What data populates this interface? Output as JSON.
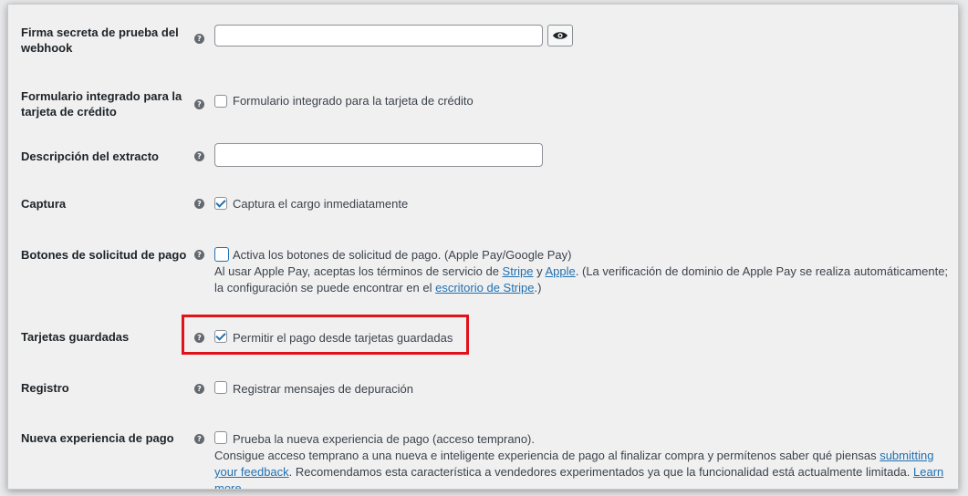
{
  "rows": {
    "webhook": {
      "label": "Firma secreta de prueba del webhook",
      "value": ""
    },
    "form": {
      "label": "Formulario integrado para la tarjeta de crédito",
      "checkbox": "Formulario integrado para la tarjeta de crédito",
      "checked": false
    },
    "statement": {
      "label": "Descripción del extracto",
      "value": ""
    },
    "capture": {
      "label": "Captura",
      "checkbox": "Captura el cargo inmediatamente",
      "checked": true
    },
    "payreq": {
      "label": "Botones de solicitud de pago",
      "checkbox": "Activa los botones de solicitud de pago. (Apple Pay/Google Pay)",
      "checked": false,
      "desc_a": "Al usar Apple Pay, aceptas los términos de servicio de ",
      "link_stripe": "Stripe",
      "desc_b": " y ",
      "link_apple": "Apple",
      "desc_c": ". (La verificación de dominio de Apple Pay se realiza automáticamente; la configuración se puede encontrar en el ",
      "link_dashboard": "escritorio de Stripe",
      "desc_d": ".)"
    },
    "saved": {
      "label": "Tarjetas guardadas",
      "checkbox": "Permitir el pago desde tarjetas guardadas",
      "checked": true
    },
    "log": {
      "label": "Registro",
      "checkbox": "Registrar mensajes de depuración",
      "checked": false
    },
    "newexp": {
      "label": "Nueva experiencia de pago",
      "checkbox": "Prueba la nueva experiencia de pago (acceso temprano).",
      "checked": false,
      "desc_a": "Consigue acceso temprano a una nueva e inteligente experiencia de pago al finalizar compra y permítenos saber qué piensas ",
      "link_feedback": "submitting your feedback",
      "desc_b": ". Recomendamos esta característica a vendedores experimentados ya que la funcionalidad está actualmente limitada. ",
      "link_learn": "Learn more"
    }
  },
  "help_glyph": "?",
  "highlight_color": "#e0121b",
  "accent_color": "#2271b1"
}
